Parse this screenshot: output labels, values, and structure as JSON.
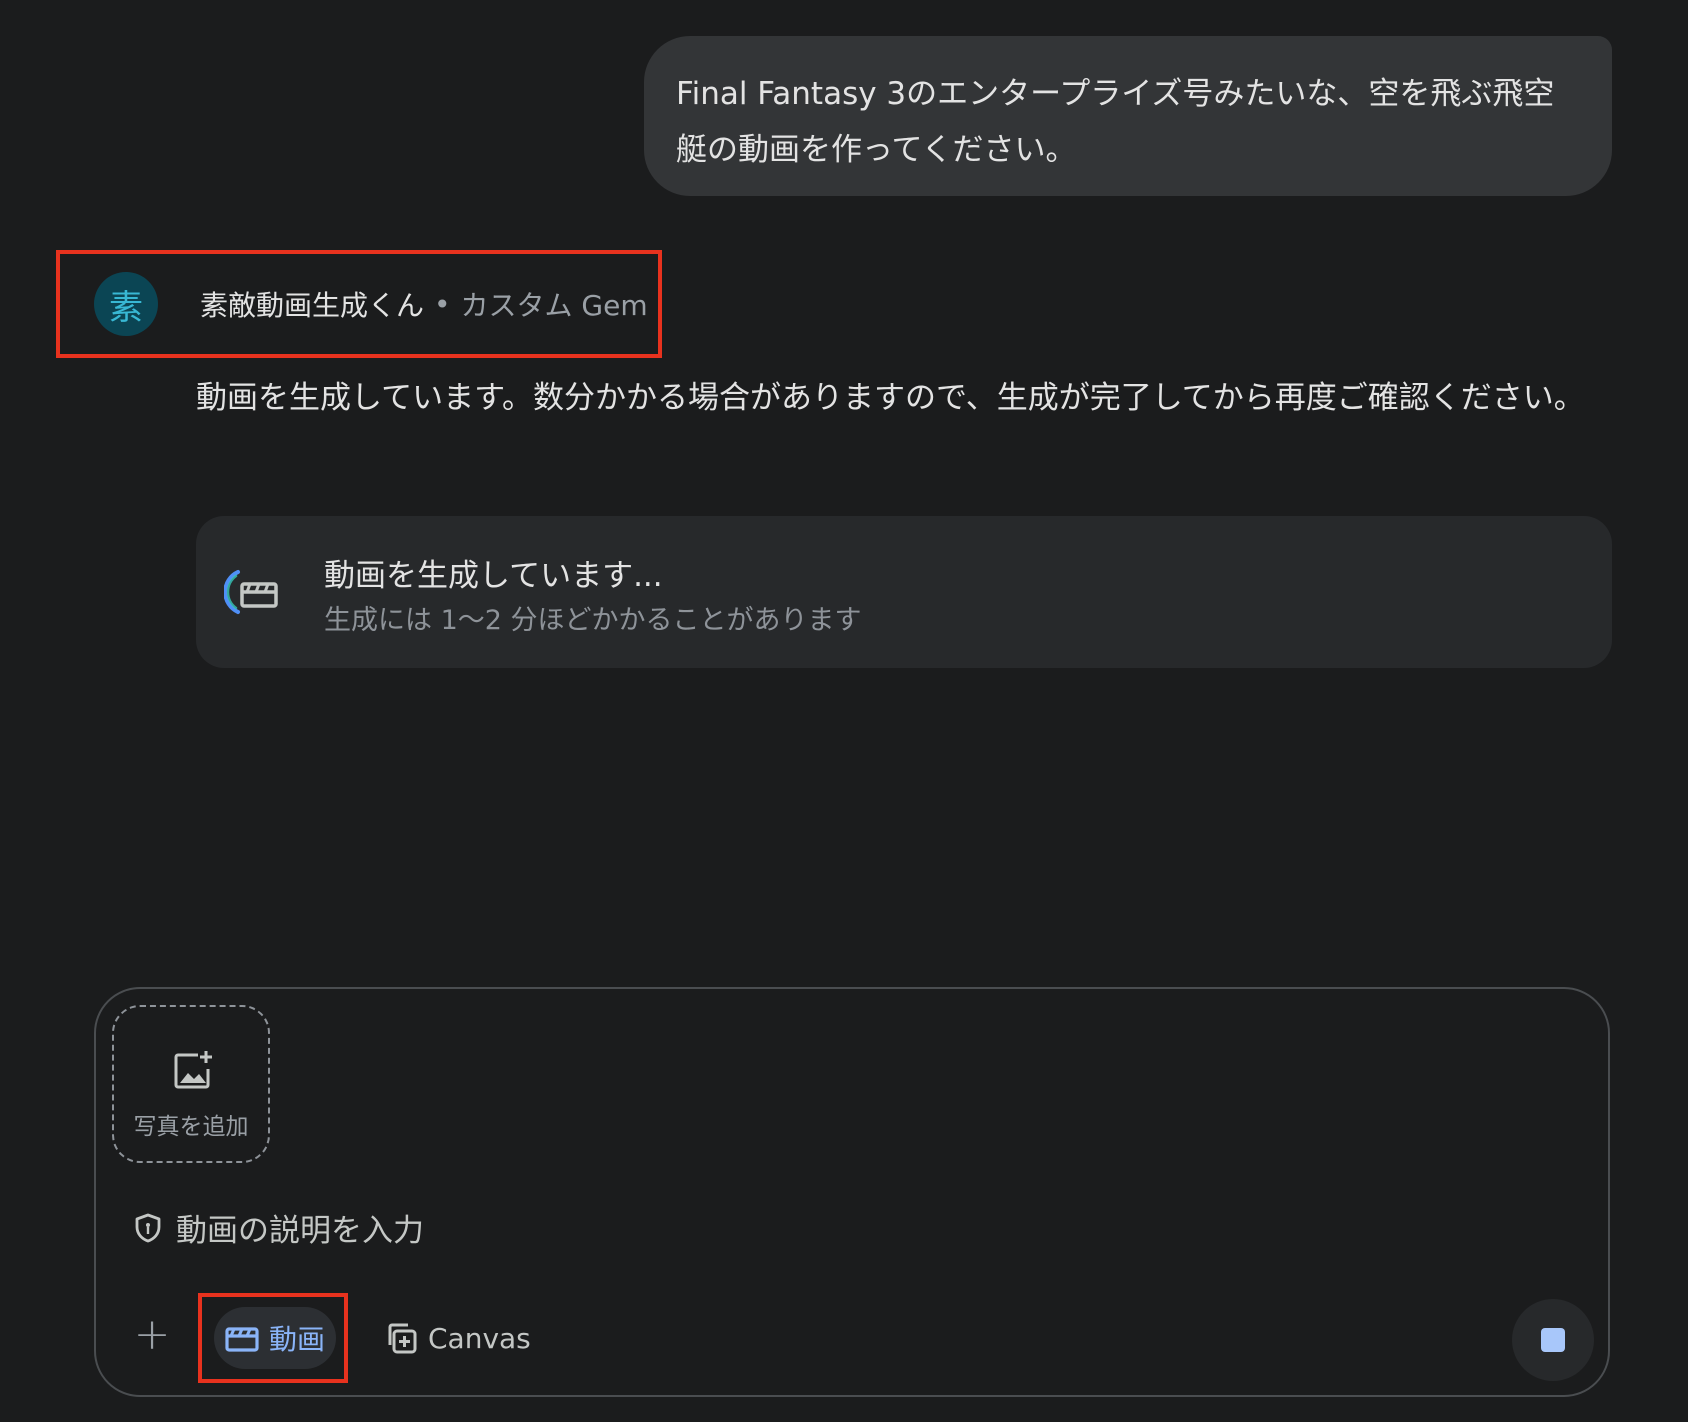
{
  "user_message": {
    "line1": "Final Fantasy 3のエンタープライズ号みたいな、空を飛ぶ飛空",
    "line2": "艇の動画を作ってください。"
  },
  "gem": {
    "avatar_char": "素",
    "name": "素敵動画生成くん",
    "separator": "•",
    "tag": "カスタム Gem"
  },
  "response": {
    "text": "動画を生成しています。数分かかる場合がありますので、生成が完了してから再度ご確認ください。"
  },
  "generating_card": {
    "title": "動画を生成しています...",
    "subtitle": "生成には 1〜2 分ほどかかることがあります"
  },
  "composer": {
    "add_photo_label": "写真を追加",
    "placeholder": "動画の説明を入力",
    "plus_label": "+",
    "video_chip_label": "動画",
    "canvas_chip_label": "Canvas"
  },
  "colors": {
    "background": "#1b1c1d",
    "accent_blue": "#8ab4f8",
    "highlight_red": "#e8321e",
    "avatar_bg": "#0b4554",
    "avatar_fg": "#38b8d4"
  },
  "icons": {
    "generating": "clapperboard-icon",
    "add_photo": "add-photo-icon",
    "shield": "shield-icon",
    "video": "clapperboard-icon",
    "canvas": "canvas-icon",
    "stop": "stop-icon"
  }
}
